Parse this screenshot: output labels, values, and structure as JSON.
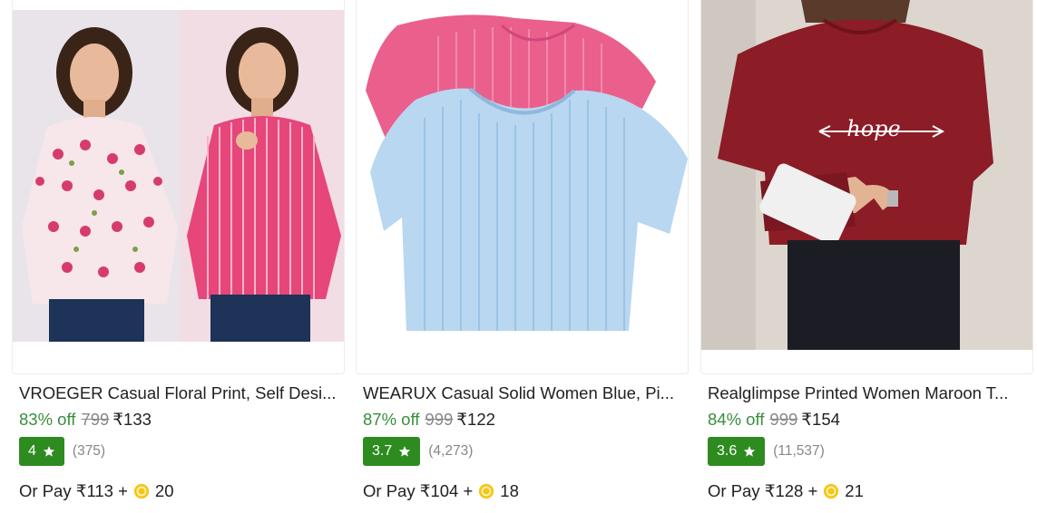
{
  "products": [
    {
      "image_alt": "Two women wearing floral print and pink striped tops",
      "title": "VROEGER Casual Floral Print, Self Desi...",
      "discount": "83% off",
      "mrp": "799",
      "price": "₹133",
      "rating": "4",
      "rating_count": "(375)",
      "pay_prefix": "Or Pay ₹113 +",
      "coins": "20"
    },
    {
      "image_alt": "Pink and blue ribbed crop tops",
      "title": "WEARUX Casual Solid Women Blue, Pi...",
      "discount": "87% off",
      "mrp": "999",
      "price": "₹122",
      "rating": "3.7",
      "rating_count": "(4,273)",
      "pay_prefix": "Or Pay ₹104 +",
      "coins": "18"
    },
    {
      "image_alt": "Woman in maroon t-shirt with hope print",
      "title": "Realglimpse Printed Women Maroon T...",
      "discount": "84% off",
      "mrp": "999",
      "price": "₹154",
      "rating": "3.6",
      "rating_count": "(11,537)",
      "pay_prefix": "Or Pay ₹128 +",
      "coins": "21"
    }
  ],
  "colors": {
    "discount": "#388e3c",
    "rating_badge": "#2e8b20",
    "coin": "#f5c518"
  }
}
